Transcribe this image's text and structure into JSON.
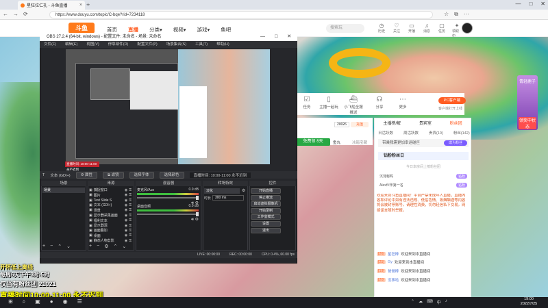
{
  "browser": {
    "tab_title": "星狂拉仁孔 - 斗鱼直播",
    "url": "https://www.douyu.com/topic/C-bqe?rid=7234118",
    "new_tab": "+",
    "winctl": [
      "—",
      "□",
      "✕"
    ],
    "nav": [
      "←",
      "→",
      "⟳"
    ],
    "tools": [
      "☆",
      "⧉",
      "⋯"
    ]
  },
  "site": {
    "logo": "斗鱼",
    "nav": [
      {
        "label": "首页",
        "active": false
      },
      {
        "label": "直播",
        "active": true
      },
      {
        "label": "分类▾",
        "active": false
      },
      {
        "label": "视频▾",
        "active": false
      },
      {
        "label": "游戏▾",
        "active": false
      },
      {
        "label": "鱼吧",
        "active": false
      }
    ],
    "search_placeholder": "搜索玩",
    "header_icons": [
      {
        "label": "历史",
        "icon": "clock-icon"
      },
      {
        "label": "关注",
        "icon": "heart-icon"
      },
      {
        "label": "开播",
        "icon": "camera-icon"
      },
      {
        "label": "消息",
        "icon": "bell-icon"
      },
      {
        "label": "任务",
        "icon": "task-icon"
      },
      {
        "label": "领取中",
        "icon": "gift-icon"
      }
    ]
  },
  "room": {
    "tools": [
      {
        "label": "任务",
        "icon": "checklist-icon"
      },
      {
        "label": "主播一起玩",
        "icon": "phone-icon"
      },
      {
        "label": "小飞船全服推送",
        "icon": "ship-icon"
      },
      {
        "label": "分享",
        "icon": "share-icon"
      },
      {
        "label": "更多",
        "icon": "more-icon"
      }
    ],
    "pc_button": "PC客户端",
    "pc_sub": "客户端打开上线",
    "gift_value": "20026",
    "gift_btn": "充值",
    "green_label": "免费领·5天",
    "tag1": "鱼丸",
    "tag2": "冰箱宝藏"
  },
  "side_ad": {
    "title": "青轻鹿子",
    "cta": "领奖中状态"
  },
  "chat": {
    "tabs": [
      {
        "label": "主播榜/解",
        "active": false
      },
      {
        "label": "贵宾室",
        "active": false
      },
      {
        "label": "粉丝团",
        "active": true
      }
    ],
    "sub": [
      "日活跃数",
      "周活跃数",
      "贵宾(10)",
      "粉丝(142)"
    ],
    "notice": "带乘我需更加幸运碰巨",
    "notice_btn": "成为粉丝",
    "fan_title": "钻粉粉丝日",
    "fan_sub": "今日本房间上榜粉丝团",
    "fans": [
      {
        "name": "沉淀秘码",
        "badge": "钻粉"
      },
      {
        "name": "Alex伙伴第一名",
        "badge": "钻粉"
      }
    ],
    "system_notice": "欢迎来到斗鱼直播间！平台严禁未成年人直播，直播内容和评论中如有违法违规、低俗色情、吸烟酗酒等内容将会被封停账号。请理性消费，切勿轻信私下交易。网络谣言随时举报。",
    "messages": [
      {
        "lv": "[26]",
        "name": "星狂棒",
        "text": "欢迎来到本直播间"
      },
      {
        "lv": "[25]",
        "name": "Gy",
        "text": "欢迎来到本直播间"
      },
      {
        "lv": "[19]",
        "name": "爸爸棒",
        "text": "欢迎来到本直播间"
      },
      {
        "lv": "[20]",
        "name": "没事哈",
        "text": "欢迎来到本直播间"
      }
    ]
  },
  "obs": {
    "title": "OBS 27.2.4 (64-bit, windows) - 配置文件: 未命名 - 场景: 未命名",
    "menu": [
      "文件(F)",
      "编辑(E)",
      "视图(V)",
      "停靠部件(D)",
      "配置文件(P)",
      "场景集合(S)",
      "工具(T)",
      "帮助(H)"
    ],
    "source_bar": {
      "label": "文本 (GDI+)",
      "buttons": [
        "⚙ 属性",
        "⧉ 滤镜",
        "选择字体",
        "选择颜色"
      ],
      "time_text": "直播时间: 10:00-11:00 永不迟到"
    },
    "docks": {
      "scenes": "场景",
      "sources": "来源",
      "mixer": "混音器",
      "transitions": "转场特效",
      "controls": "控件"
    },
    "scene_item": "场景",
    "sources": [
      "捕捉窗口",
      "图片",
      "Text Slide S",
      "文本 (GDI+)",
      "场景",
      "显示器采集画面",
      "福利文本",
      "显示器源",
      "画面叠加",
      "桌面",
      "静态人物剪影"
    ],
    "mixer": [
      {
        "name": "麦克风/Aux",
        "db": "0.0 dB"
      },
      {
        "name": "桌面音频",
        "db": "0.0 dB"
      }
    ],
    "transition": {
      "type": "淡化",
      "duration_label": "时长",
      "duration": "300 ms"
    },
    "controls": [
      "开始直播",
      "停止推流",
      "启动虚拟摄像机",
      "开始录制",
      "工作室模式",
      "设置",
      "退出"
    ],
    "status": [
      "LIVE: 00:00:00",
      "REC: 00:00:00",
      "CPU: 0.4%, 60.00 fps"
    ]
  },
  "overlay": {
    "line1": "开怀低上离线",
    "line2": "每周6天下午3时-5时",
    "line3": "仅当有粉丝团 21021",
    "line4": "直播时间10:00-11:00 永不迟到"
  },
  "taskbar": {
    "icons": [
      "⊞",
      "⌕",
      "▣",
      "●",
      "◉",
      "☰"
    ],
    "tray": [
      "⌃",
      "☁",
      "⌨",
      "中",
      "♪"
    ],
    "time": "19:00",
    "date": "2022/7/25"
  }
}
